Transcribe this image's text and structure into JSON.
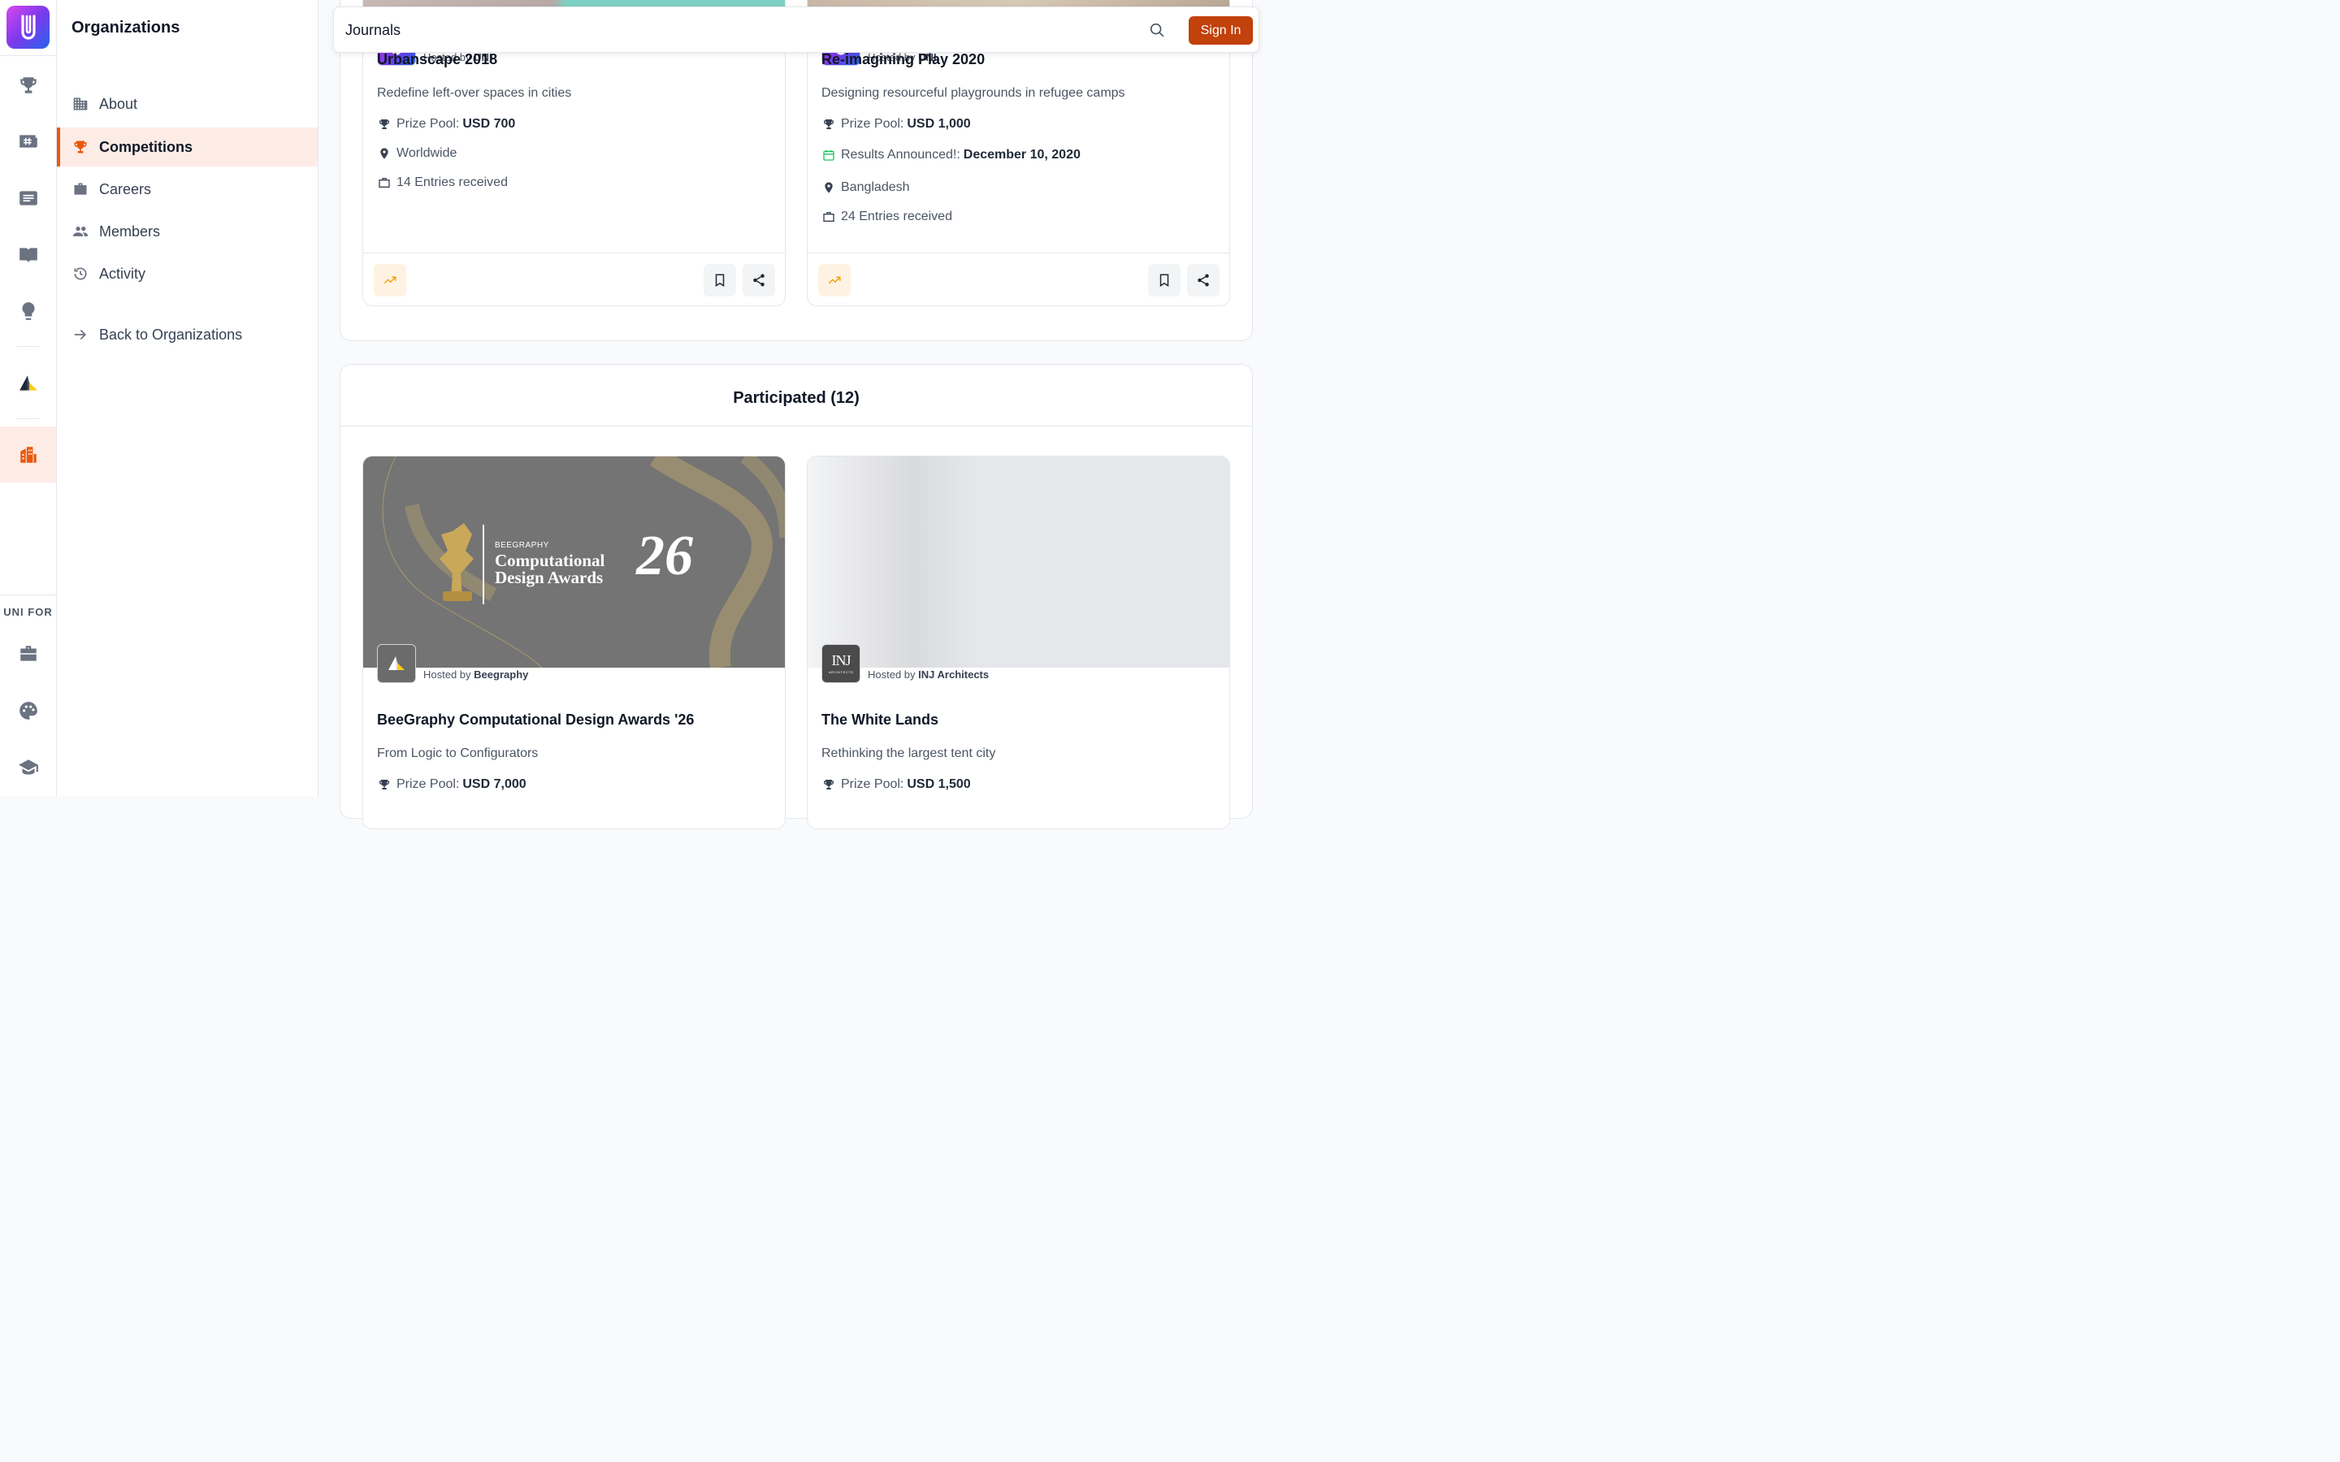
{
  "rail": {
    "label": "UNI FOR"
  },
  "sidebar": {
    "title": "Organizations",
    "items": [
      {
        "label": "About"
      },
      {
        "label": "Competitions"
      },
      {
        "label": "Careers"
      },
      {
        "label": "Members"
      },
      {
        "label": "Activity"
      }
    ],
    "back_label": "Back to Organizations"
  },
  "topbar": {
    "search_value": "Journals",
    "signin_label": "Sign In"
  },
  "hosted_section": {
    "cards": [
      {
        "host_prefix": "Hosted by",
        "host_name": "UNI",
        "title": "Urbanscape 2018",
        "desc": "Redefine left-over spaces in cities",
        "prize_label": "Prize Pool:",
        "prize_value": "USD 700",
        "location": "Worldwide",
        "entries": "14 Entries received"
      },
      {
        "host_prefix": "Hosted by",
        "host_name": "UNI",
        "title": "Re-imagining Play 2020",
        "desc": "Designing resourceful playgrounds in refugee camps",
        "prize_label": "Prize Pool:",
        "prize_value": "USD 1,000",
        "results_label": "Results Announced!:",
        "results_value": "December 10, 2020",
        "location": "Bangladesh",
        "entries": "24 Entries received"
      }
    ]
  },
  "participated_section": {
    "title": "Participated (12)",
    "cards": [
      {
        "banner_small": "BEEGRAPHY",
        "banner_line1": "Computational",
        "banner_line2": "Design Awards",
        "banner_number": "26",
        "host_prefix": "Hosted by",
        "host_name": "Beegraphy",
        "title": "BeeGraphy Computational Design Awards '26",
        "desc": "From Logic to Configurators",
        "prize_label": "Prize Pool:",
        "prize_value": "USD 7,000"
      },
      {
        "logo_text": "INJ",
        "logo_sub": "ARCHITECTS",
        "host_prefix": "Hosted by",
        "host_name": "INJ Architects",
        "title": "The White Lands",
        "desc": "Rethinking the largest tent city",
        "prize_label": "Prize Pool:",
        "prize_value": "USD 1,500"
      }
    ]
  }
}
